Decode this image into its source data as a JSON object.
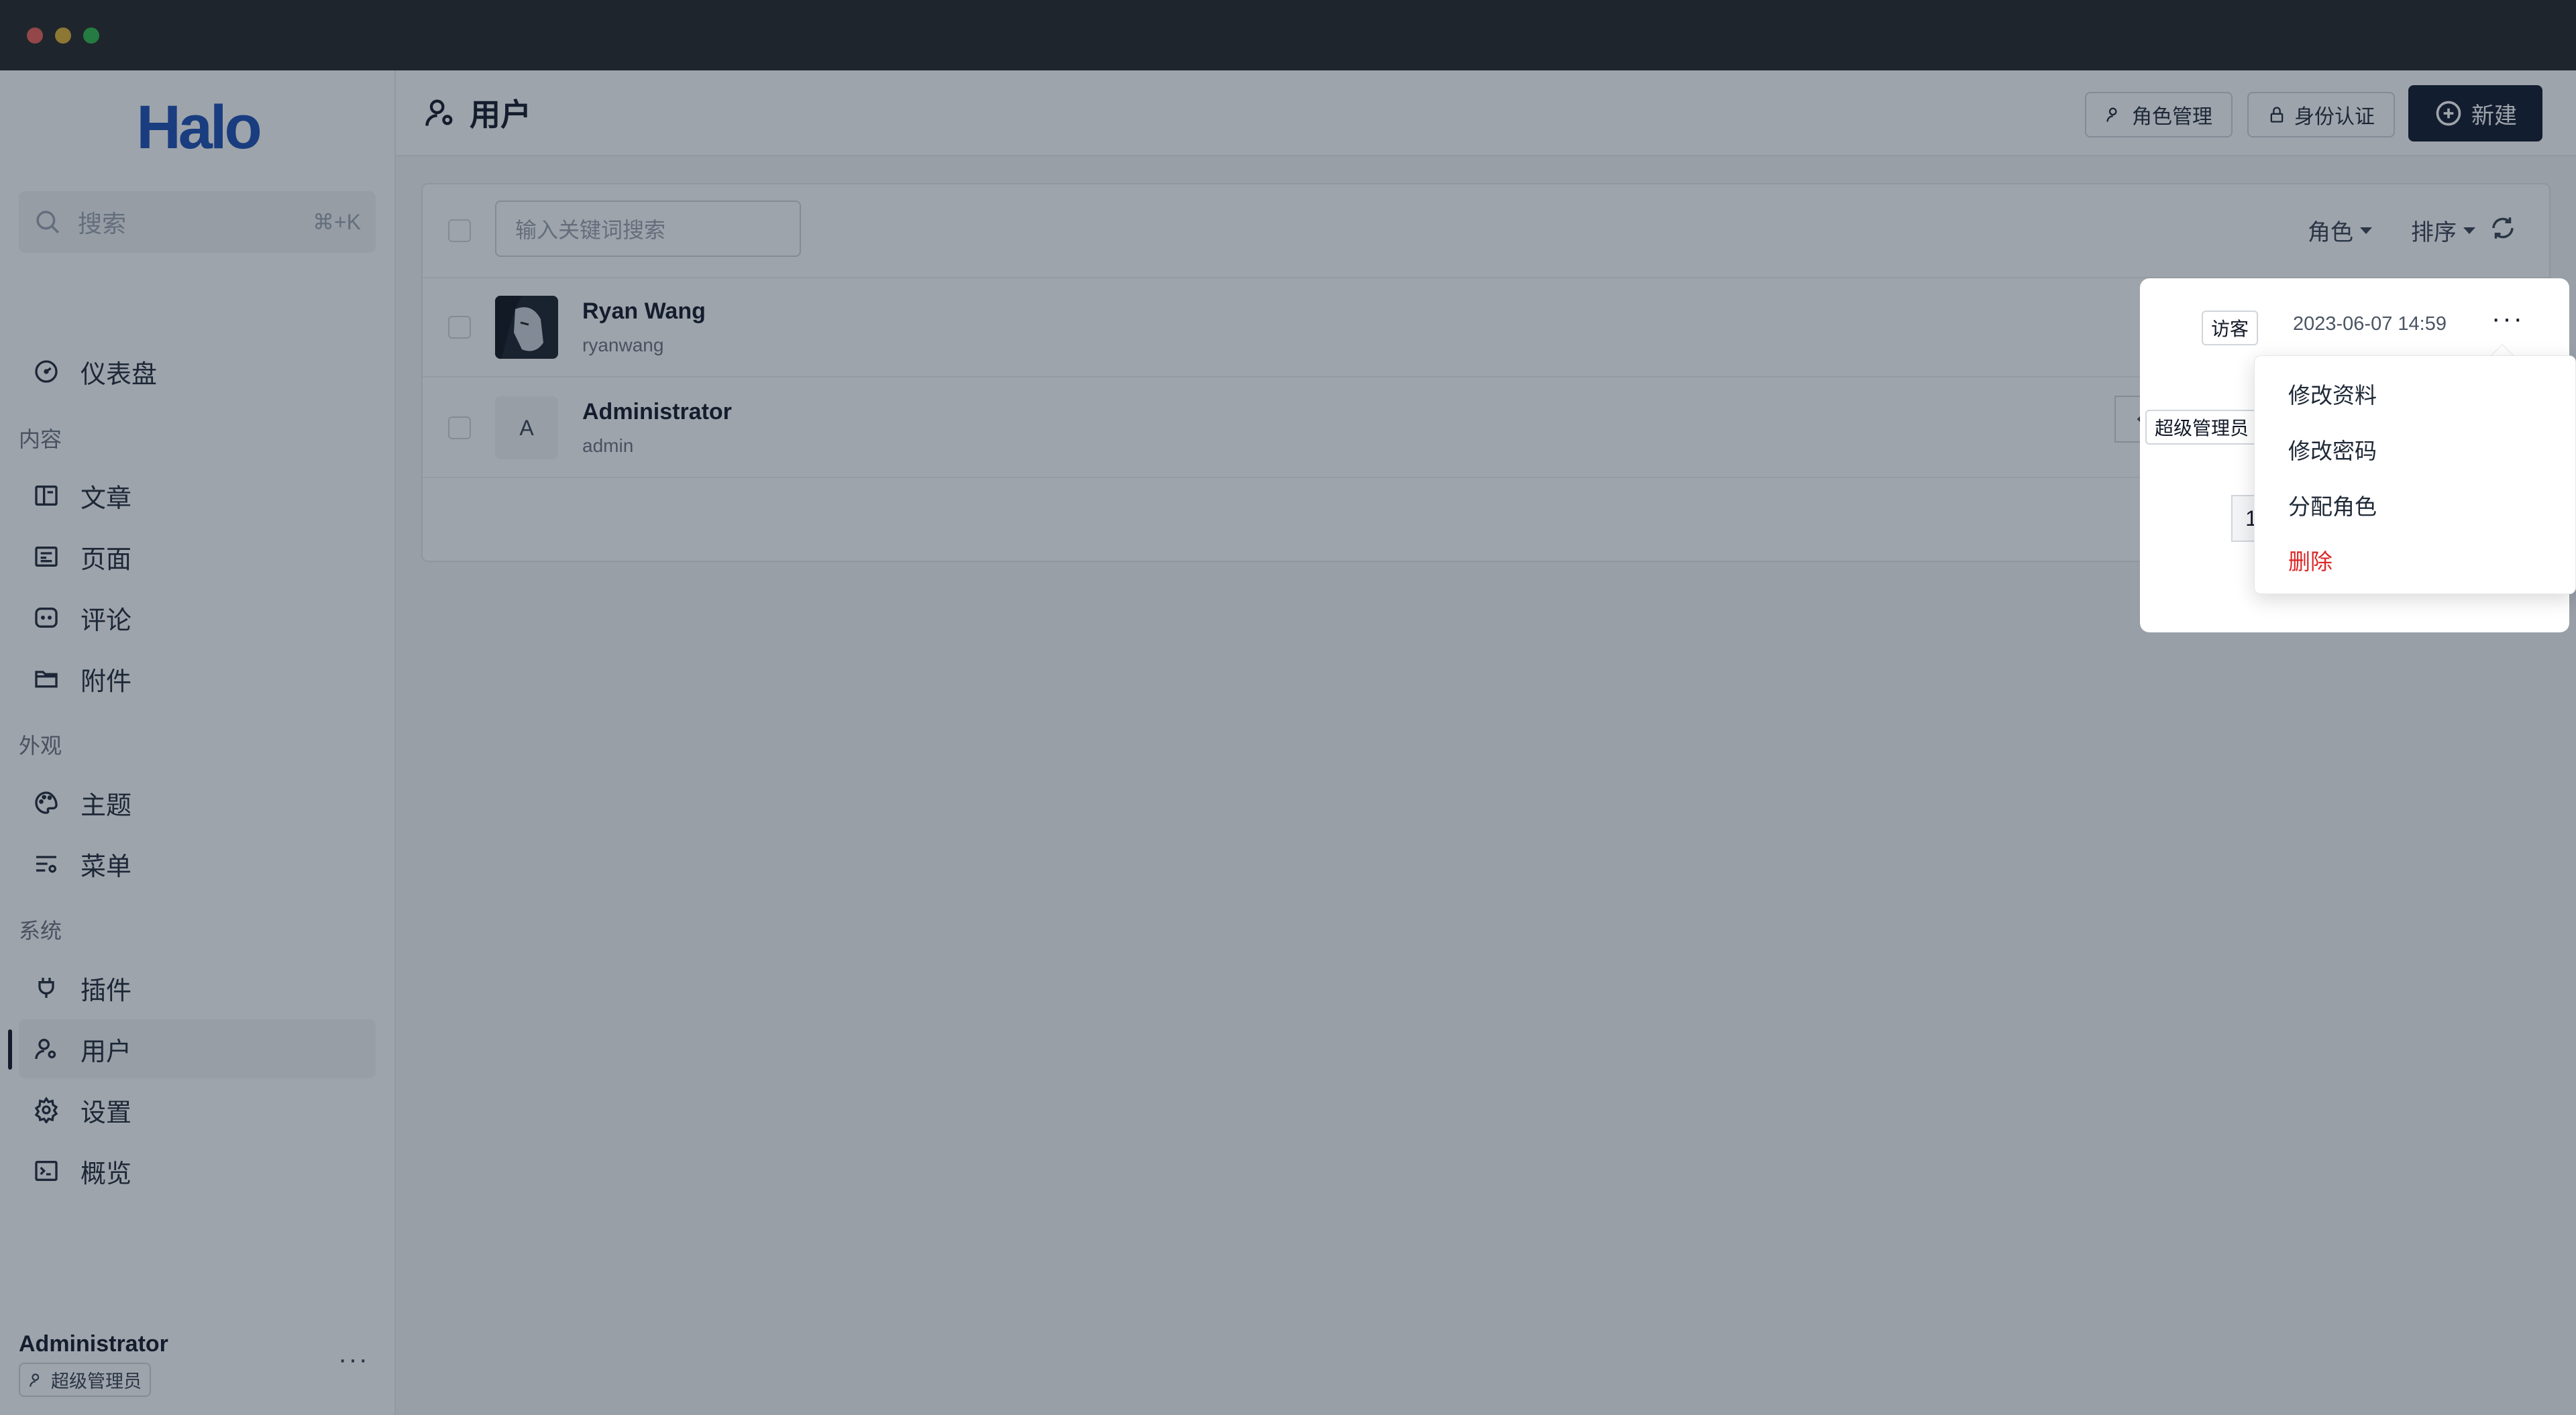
{
  "sidebar": {
    "logo": "Halo",
    "search": {
      "placeholder": "搜索",
      "shortcut": "⌘+K"
    },
    "top_item": {
      "label": "仪表盘",
      "icon": "dashboard-icon"
    },
    "sections": [
      {
        "title": "内容",
        "items": [
          {
            "label": "文章",
            "icon": "post-icon"
          },
          {
            "label": "页面",
            "icon": "page-icon"
          },
          {
            "label": "评论",
            "icon": "comment-icon"
          },
          {
            "label": "附件",
            "icon": "folder-icon"
          }
        ]
      },
      {
        "title": "外观",
        "items": [
          {
            "label": "主题",
            "icon": "palette-icon"
          },
          {
            "label": "菜单",
            "icon": "menu-icon"
          }
        ]
      },
      {
        "title": "系统",
        "items": [
          {
            "label": "插件",
            "icon": "plug-icon"
          },
          {
            "label": "用户",
            "icon": "user-settings-icon",
            "active": true
          },
          {
            "label": "设置",
            "icon": "gear-icon"
          },
          {
            "label": "概览",
            "icon": "terminal-icon"
          }
        ]
      }
    ],
    "footer": {
      "name": "Administrator",
      "role": "超级管理员",
      "more": "···"
    }
  },
  "header": {
    "title": "用户",
    "buttons": {
      "roles": "角色管理",
      "auth": "身份认证",
      "new": "新建"
    }
  },
  "toolbar": {
    "search_placeholder": "输入关键词搜索",
    "filter_role": "角色",
    "filter_sort": "排序"
  },
  "users": [
    {
      "name": "Ryan Wang",
      "username": "ryanwang",
      "role": "访客",
      "created": "2023-06-07 14:59",
      "avatar": "photo"
    },
    {
      "name": "Administrator",
      "username": "admin",
      "role": "超级管理员",
      "avatar_letter": "A"
    }
  ],
  "pagination": {
    "current_page": "1"
  },
  "row_menu": {
    "items": [
      "修改资料",
      "修改密码",
      "分配角色"
    ],
    "danger_item": "删除"
  },
  "colors": {
    "brand": "#1a4fb4",
    "primary_button": "#0f172a",
    "danger": "#dc2626"
  }
}
